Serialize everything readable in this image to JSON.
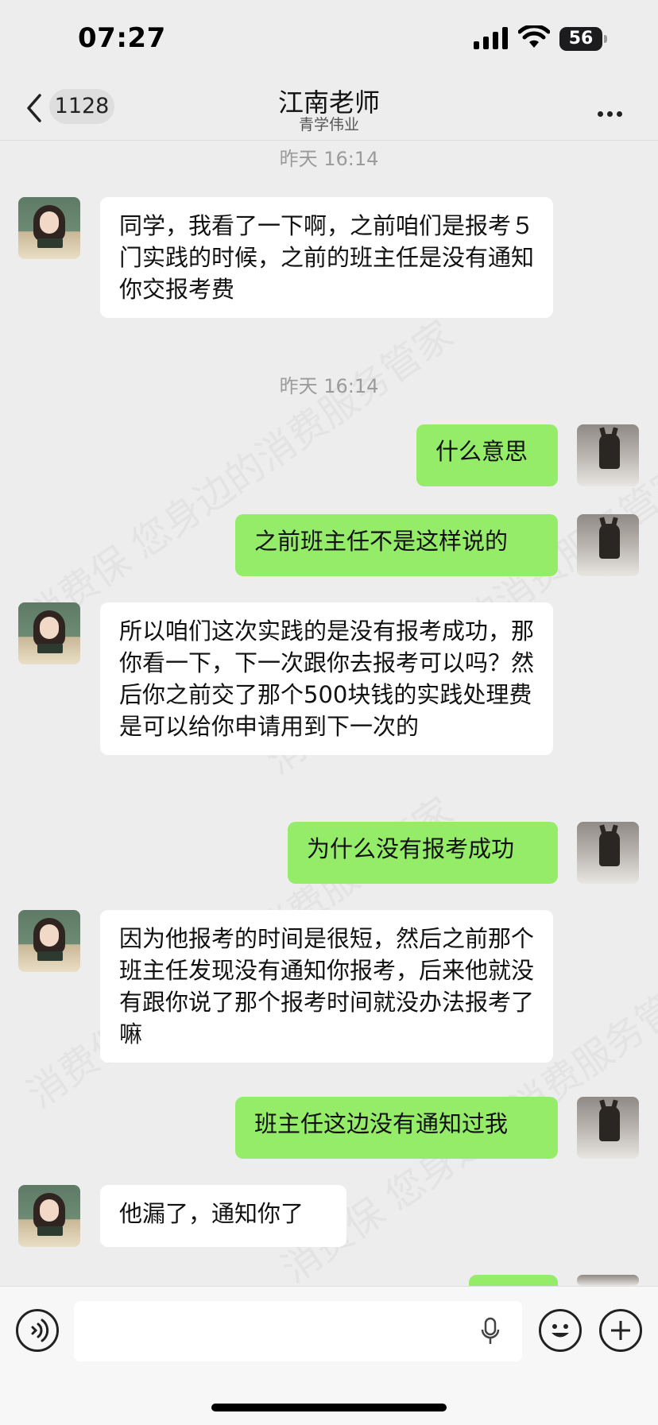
{
  "status_bar": {
    "time": "07:27",
    "battery": "56"
  },
  "nav": {
    "back_count": "1128",
    "title": "江南老师",
    "subtitle": "青学伟业"
  },
  "messages": [
    {
      "type": "timestamp",
      "text": "昨天 16:14"
    },
    {
      "type": "incoming",
      "text": "同学，我看了一下啊，之前咱们是报考５门实践的时候，之前的班主任是没有通知你交报考费"
    },
    {
      "type": "timestamp",
      "text": "昨天 16:14"
    },
    {
      "type": "outgoing",
      "text": "什么意思"
    },
    {
      "type": "outgoing",
      "text": "之前班主任不是这样说的"
    },
    {
      "type": "incoming",
      "text": "所以咱们这次实践的是没有报考成功，那你看一下，下一次跟你去报考可以吗？然后你之前交了那个500块钱的实践处理费是可以给你申请用到下一次的"
    },
    {
      "type": "outgoing",
      "text": "为什么没有报考成功"
    },
    {
      "type": "incoming",
      "text": "因为他报考的时间是很短，然后之前那个班主任发现没有通知你报考，后来他就没有跟你说了那个报考时间就没办法报考了嘛"
    },
    {
      "type": "outgoing",
      "text": "班主任这边没有通知过我"
    },
    {
      "type": "incoming",
      "text": "他漏了，通知你了"
    }
  ],
  "watermark": "消费保 您身边的消费服务管家",
  "colors": {
    "outgoing_bubble": "#95ec69",
    "incoming_bubble": "#ffffff",
    "background": "#ededed"
  },
  "icons": [
    "back-chevron-icon",
    "more-icon",
    "voice-icon",
    "mic-icon",
    "emoji-icon",
    "plus-icon"
  ]
}
